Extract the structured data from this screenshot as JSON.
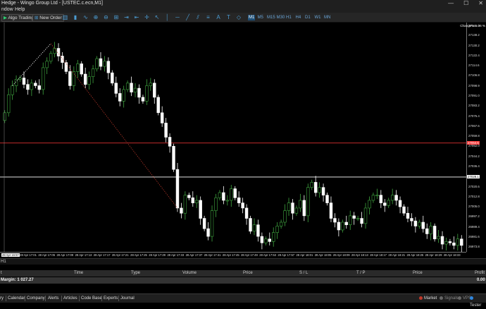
{
  "window": {
    "title": "Hedge - Wingo Group Ltd - [USTEC.c.ecn,M1]",
    "min_glyph": "—",
    "max_glyph": "☐",
    "close_glyph": "✕"
  },
  "menu": {
    "items": [
      "ndow",
      "Help"
    ]
  },
  "toolbar": {
    "algo_label": "Algo Trading",
    "new_order_label": "New Order",
    "timeframes": [
      "M1",
      "M5",
      "M15",
      "M30",
      "H1",
      "H4",
      "D1",
      "W1",
      "MN"
    ],
    "selected_timeframe": "M1",
    "icons": [
      "chart-bars-icon",
      "chart-candles-icon",
      "chart-line-icon",
      "zoom-in-icon",
      "zoom-out-icon",
      "grid-icon",
      "autoscroll-icon",
      "chart-shift-icon",
      "crosshair-icon",
      "cursor-icon",
      "vertical-line-icon",
      "horizontal-line-icon",
      "trendline-icon",
      "equidistant-channel-icon",
      "fibonacci-icon",
      "text-icon",
      "label-icon",
      "shapes-icon"
    ]
  },
  "chart_data": {
    "type": "candlestick",
    "symbol": "USTEC.c.ecn",
    "timeframe": "M1",
    "change_label": "Change% 5.06 %",
    "ylim": [
      26970,
      27148
    ],
    "y_ticks": [
      27145.0,
      27138.2,
      27130.2,
      27122.4,
      27114.6,
      27106.8,
      27098.9,
      27091.0,
      27083.2,
      27075.4,
      27067.6,
      27059.8,
      27052.0,
      27044.2,
      27036.4,
      27028.4,
      27020.6,
      27012.8,
      27005.0,
      26997.2,
      26989.4,
      26981.6,
      26973.8
    ],
    "bid_line": 27054.5,
    "bid_label": "27054.5",
    "ask_line": 27028.1,
    "ask_label": "27028.1",
    "x_labels": [
      "28 Apr 16:57",
      "28 Apr 17:01",
      "28 Apr 17:05",
      "28 Apr 17:09",
      "28 Apr 17:13",
      "28 Apr 17:17",
      "28 Apr 17:21",
      "28 Apr 17:25",
      "28 Apr 17:29",
      "28 Apr 17:33",
      "28 Apr 17:37",
      "28 Apr 17:41",
      "28 Apr 17:45",
      "28 Apr 17:49",
      "28 Apr 17:53",
      "28 Apr 17:57",
      "28 Apr 18:01",
      "28 Apr 18:05",
      "28 Apr 18:09",
      "28 Apr 18:13",
      "28 Apr 18:17",
      "28 Apr 18:21",
      "28 Apr 18:25",
      "28 Apr 18:29",
      "28 Apr 18:33"
    ],
    "close": [
      27078,
      27092,
      27099,
      27104,
      27105,
      27100,
      27096,
      27101,
      27099,
      27096,
      27113,
      27118,
      27124,
      27128,
      27122,
      27117,
      27110,
      27099,
      27110,
      27116,
      27108,
      27100,
      27106,
      27112,
      27120,
      27114,
      27118,
      27109,
      27101,
      27093,
      27087,
      27096,
      27101,
      27094,
      27097,
      27090,
      27087,
      27099,
      27101,
      27090,
      27078,
      27070,
      27059,
      27052,
      27034,
      27004,
      27000,
      27014,
      27012,
      27008,
      27010,
      26996,
      26988,
      26982,
      27002,
      27012,
      27016,
      27010,
      27010,
      27019,
      27012,
      27008,
      27004,
      26996,
      26986,
      26991,
      26982,
      26977,
      26980,
      26978,
      26985,
      26990,
      26993,
      27002,
      27008,
      27000,
      27004,
      27010,
      26998,
      27020,
      27024,
      27016,
      27020,
      27014,
      27008,
      26996,
      26993,
      26987,
      26993,
      26991,
      26998,
      26996,
      26996,
      26992,
      27004,
      27010,
      27014,
      27014,
      27008,
      27006,
      27010,
      27014,
      27010,
      27005,
      27000,
      26996,
      26994,
      26990,
      26993,
      26988,
      26984,
      26990,
      26980,
      26982,
      26976,
      26978,
      26977,
      26975,
      26980,
      26975
    ]
  },
  "orders_panel": {
    "tab_label": "H1",
    "columns": [
      "t",
      "Time",
      "Type",
      "Volume",
      "Price",
      "S / L",
      "T / P",
      "Price",
      "Profit"
    ],
    "margin_label": "Margin: 1 027.27",
    "profit_value": "0.00"
  },
  "bottom_tabs": [
    "ry",
    "Calendar",
    "Company",
    "Alerts",
    "Articles",
    "Code Base",
    "Experts",
    "Journal"
  ],
  "status_right": [
    {
      "label": "Market",
      "color": "#c0392b"
    },
    {
      "label": "Signals",
      "color": "#666666"
    },
    {
      "label": "VPS",
      "color": "#666666"
    },
    {
      "label": "Tester",
      "color": "#2e86de"
    }
  ],
  "colors": {
    "bull": "#3fa53f",
    "bear": "#ffffff",
    "bid": "#ff3b3b",
    "ask": "#ffffff",
    "trendline": "#c0392b"
  }
}
